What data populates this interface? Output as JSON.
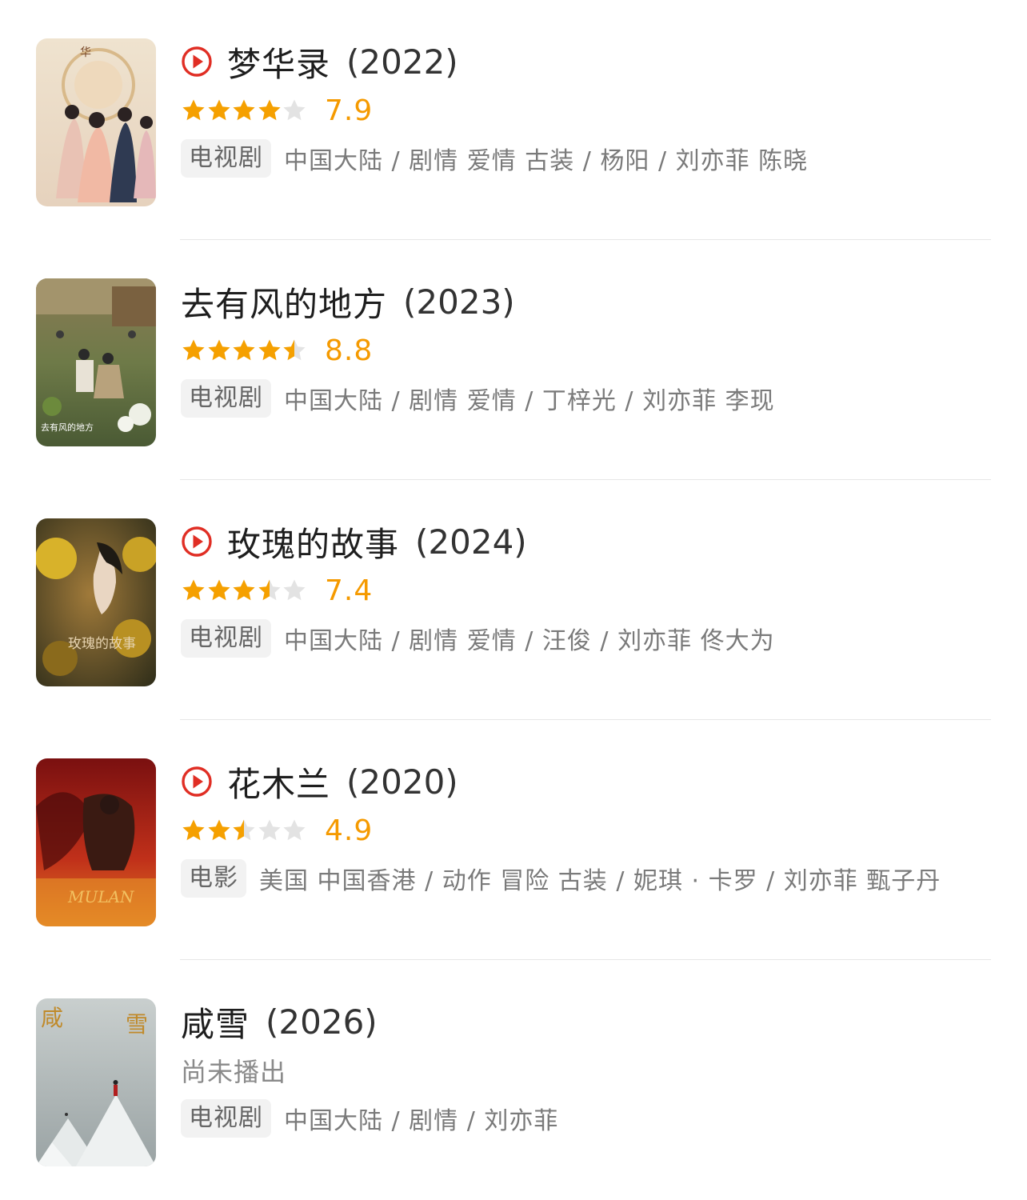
{
  "items": [
    {
      "title": "梦华录",
      "year": "(2022)",
      "playable": true,
      "rating": "7.9",
      "rating_value": 7.9,
      "stars_out_of_5": 4,
      "type_badge": "电视剧",
      "meta": "中国大陆 / 剧情 爱情 古装 / 杨阳 / 刘亦菲 陈晓"
    },
    {
      "title": "去有风的地方",
      "year": "(2023)",
      "playable": false,
      "rating": "8.8",
      "rating_value": 8.8,
      "stars_out_of_5": 4.5,
      "type_badge": "电视剧",
      "meta": "中国大陆 / 剧情 爱情 / 丁梓光 / 刘亦菲 李现"
    },
    {
      "title": "玫瑰的故事",
      "year": "(2024)",
      "playable": true,
      "rating": "7.4",
      "rating_value": 7.4,
      "stars_out_of_5": 3.5,
      "type_badge": "电视剧",
      "meta": "中国大陆 / 剧情 爱情 / 汪俊 / 刘亦菲 佟大为"
    },
    {
      "title": "花木兰",
      "year": "(2020)",
      "playable": true,
      "rating": "4.9",
      "rating_value": 4.9,
      "stars_out_of_5": 2.5,
      "type_badge": "电影",
      "meta": "美国 中国香港 / 动作 冒险 古装 / 妮琪 · 卡罗 / 刘亦菲 甄子丹"
    },
    {
      "title": "咸雪",
      "year": "(2026)",
      "playable": false,
      "status": "尚未播出",
      "type_badge": "电视剧",
      "meta": "中国大陆 / 剧情 / 刘亦菲"
    }
  ],
  "colors": {
    "star_filled": "#f5a000",
    "star_empty": "#e3e3e3",
    "score": "#f59a00",
    "play_icon": "#e02e24"
  },
  "icons": {
    "play": "play-circle-icon",
    "star": "star-icon"
  }
}
